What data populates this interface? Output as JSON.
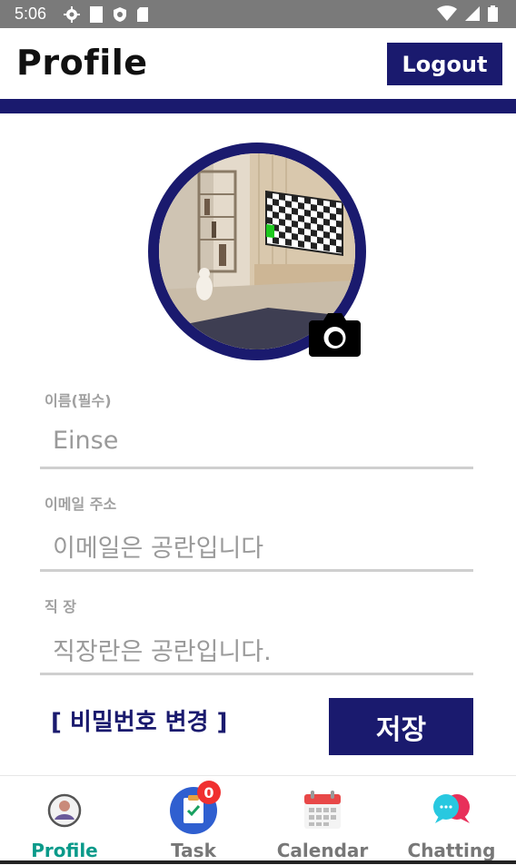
{
  "status_bar": {
    "time": "5:06",
    "left_icons": [
      "gear-icon",
      "sim-card-icon",
      "shield-icon",
      "sd-card-icon"
    ],
    "right_icons": [
      "wifi-icon",
      "signal-icon",
      "battery-icon"
    ]
  },
  "header": {
    "title": "Profile",
    "logout_label": "Logout",
    "accent_color": "#1a1a6e"
  },
  "profile": {
    "avatar_alt": "profile photo of a room with a checkered tv",
    "camera_icon": "camera-icon"
  },
  "form": {
    "name": {
      "label": "이름(필수)",
      "value": "Einse"
    },
    "email": {
      "label": "이메일 주소",
      "value": "이메일은 공란입니다"
    },
    "job": {
      "label": "직 장",
      "value": "직장란은 공란입니다."
    }
  },
  "actions": {
    "change_password": "[ 비밀번호 변경 ]",
    "save": "저장"
  },
  "bottom_nav": {
    "items": [
      {
        "label": "Profile",
        "icon": "profile-icon",
        "active": true
      },
      {
        "label": "Task",
        "icon": "clipboard-icon",
        "badge": "0"
      },
      {
        "label": "Calendar",
        "icon": "calendar-icon"
      },
      {
        "label": "Chatting",
        "icon": "chat-bubbles-icon"
      }
    ],
    "active_color": "#0a9a8a"
  }
}
